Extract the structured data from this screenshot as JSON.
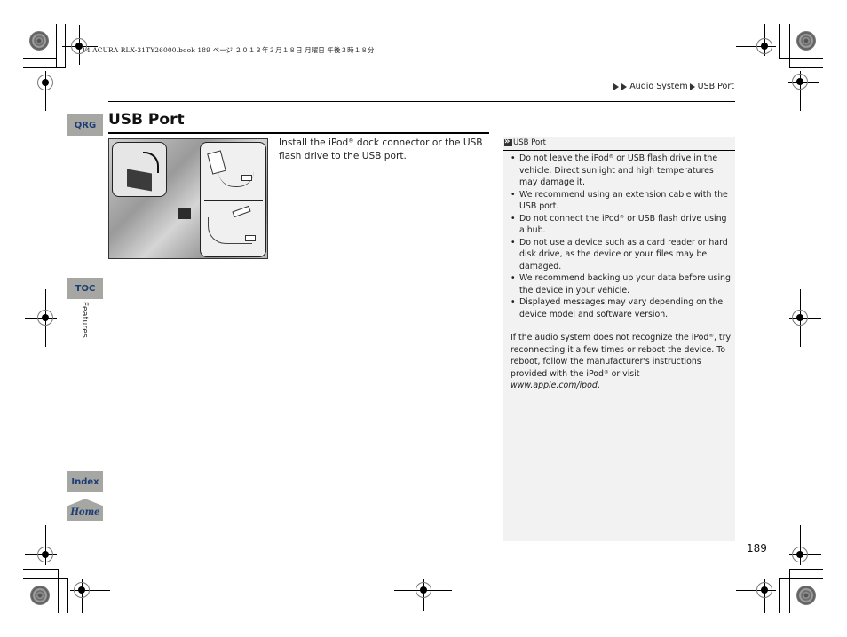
{
  "print_header": "14 ACURA RLX-31TY26000.book  189 ページ  ２０１３年３月１８日  月曜日  午後３時１８分",
  "breadcrumb": {
    "items": [
      "Audio System",
      "USB Port"
    ]
  },
  "side_tabs": {
    "qrg": "QRG",
    "toc": "TOC",
    "index": "Index",
    "home": "Home",
    "section": "Features"
  },
  "page": {
    "title": "USB Port",
    "body_pre": "Install the iPod",
    "body_reg": "®",
    "body_post": " dock connector or the USB flash drive to the USB port.",
    "illustration_alt": "USB port in center console with iPod dock connector and USB flash drive connection diagrams",
    "page_number": "189"
  },
  "sidebar": {
    "heading": "USB Port",
    "bullets": [
      {
        "pre": "Do not leave the iPod",
        "reg": "®",
        "post": " or USB flash drive in the vehicle. Direct sunlight and high temperatures may damage it."
      },
      {
        "pre": "We recommend using an extension cable with the USB port.",
        "reg": "",
        "post": ""
      },
      {
        "pre": "Do not connect the iPod",
        "reg": "®",
        "post": " or USB flash drive using a hub."
      },
      {
        "pre": "Do not use a device such as a card reader or hard disk drive, as the device or your files may be damaged.",
        "reg": "",
        "post": ""
      },
      {
        "pre": "We recommend backing up your data before using the device in your vehicle.",
        "reg": "",
        "post": ""
      },
      {
        "pre": "Displayed messages may vary depending on the device model and software version.",
        "reg": "",
        "post": ""
      }
    ],
    "note": {
      "p1": "If the audio system does not recognize the iPod",
      "reg1": "®",
      "p2": ", try reconnecting it a few times or reboot the device. To reboot, follow the manufacturer's instructions provided with the iPod",
      "reg2": "®",
      "p3": " or visit ",
      "link": "www.apple.com/ipod",
      "p4": "."
    }
  },
  "colors": {
    "tab_bg": "#a6a6a2",
    "tab_text": "#1d3d74",
    "sidebar_bg": "#f2f2f2"
  }
}
